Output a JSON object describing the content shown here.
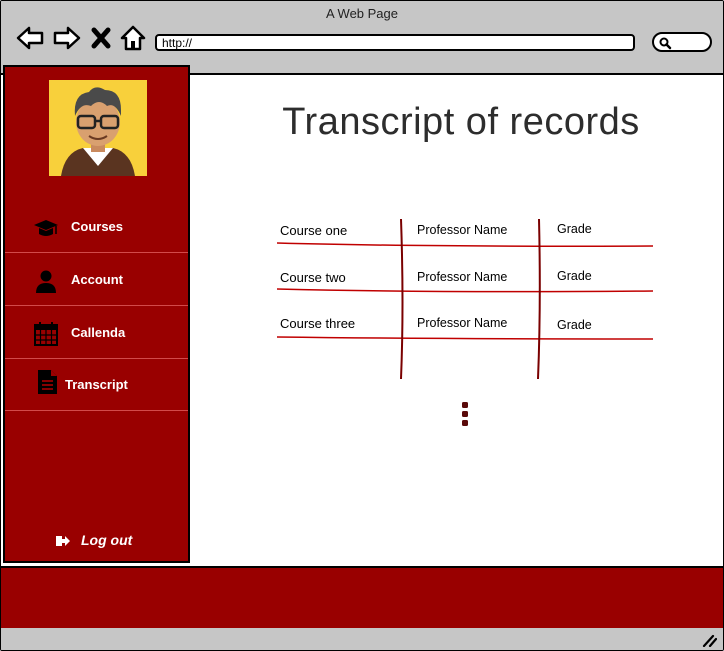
{
  "window": {
    "title": "A Web Page"
  },
  "browser": {
    "url": "http://",
    "icons": {
      "back": "back-arrow-icon",
      "forward": "forward-arrow-icon",
      "stop": "close-icon",
      "home": "home-icon",
      "search": "search-icon"
    }
  },
  "sidebar": {
    "items": [
      {
        "label": "Courses",
        "icon": "graduation-cap-icon"
      },
      {
        "label": "Account",
        "icon": "user-icon"
      },
      {
        "label": "Callenda",
        "icon": "calendar-icon"
      },
      {
        "label": "Transcript",
        "icon": "document-icon"
      }
    ],
    "logout_label": "Log out"
  },
  "main": {
    "title": "Transcript of records",
    "records": [
      {
        "course": "Course one",
        "professor": "Professor Name",
        "grade": "Grade"
      },
      {
        "course": "Course two",
        "professor": "Professor Name",
        "grade": "Grade"
      },
      {
        "course": "Course three",
        "professor": "Professor Name",
        "grade": "Grade"
      }
    ]
  },
  "colors": {
    "brand": "#990000",
    "chrome": "#c6c6c6",
    "avatar_bg": "#f8d03b",
    "table_lines": "#c00000",
    "column_lines": "#7a0000"
  }
}
